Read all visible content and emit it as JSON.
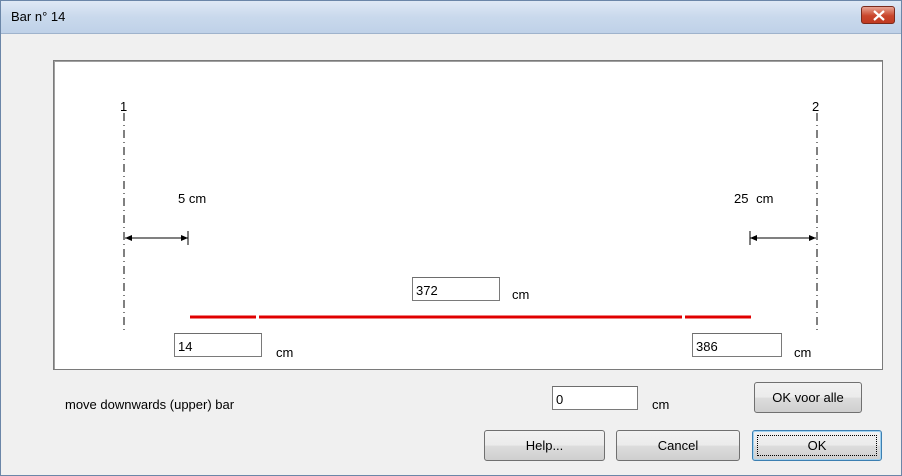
{
  "window": {
    "title": "Bar n° 14"
  },
  "diagram": {
    "support_left_label": "1",
    "support_right_label": "2",
    "left_offset": {
      "value": "5",
      "unit": "cm"
    },
    "right_offset": {
      "value": "25",
      "unit": "cm"
    },
    "bar_length": {
      "value": "372",
      "unit": "cm"
    },
    "start_position": {
      "value": "14",
      "unit": "cm"
    },
    "end_position": {
      "value": "386",
      "unit": "cm"
    },
    "bar_color": "#e00000"
  },
  "move": {
    "label": "move downwards (upper) bar",
    "value": "0",
    "unit": "cm"
  },
  "buttons": {
    "ok_all": "OK voor alle",
    "help": "Help...",
    "cancel": "Cancel",
    "ok": "OK"
  }
}
